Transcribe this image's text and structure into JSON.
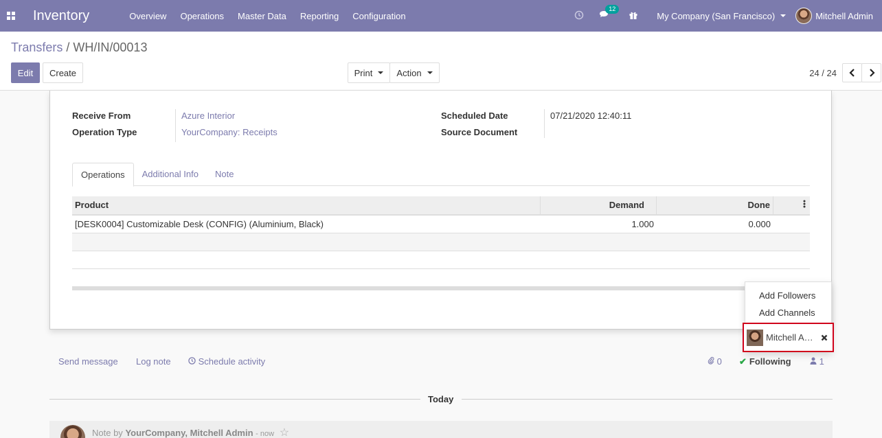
{
  "navbar": {
    "app_title": "Inventory",
    "menu": [
      "Overview",
      "Operations",
      "Master Data",
      "Reporting",
      "Configuration"
    ],
    "messages_count": "12",
    "company": "My Company (San Francisco)",
    "user": "Mitchell Admin"
  },
  "breadcrumb": {
    "parent": "Transfers",
    "separator": "/",
    "current": "WH/IN/00013"
  },
  "buttons": {
    "edit": "Edit",
    "create": "Create",
    "print": "Print",
    "action": "Action"
  },
  "pager": {
    "value": "24 / 24"
  },
  "form": {
    "receive_from_label": "Receive From",
    "receive_from": "Azure Interior",
    "operation_type_label": "Operation Type",
    "operation_type": "YourCompany: Receipts",
    "scheduled_date_label": "Scheduled Date",
    "scheduled_date": "07/21/2020 12:40:11",
    "source_document_label": "Source Document"
  },
  "tabs": [
    "Operations",
    "Additional Info",
    "Note"
  ],
  "table": {
    "headers": {
      "product": "Product",
      "demand": "Demand",
      "done": "Done"
    },
    "rows": [
      {
        "product": "[DESK0004] Customizable Desk (CONFIG) (Aluminium, Black)",
        "demand": "1.000",
        "done": "0.000"
      }
    ]
  },
  "followers_dropdown": {
    "add_followers": "Add Followers",
    "add_channels": "Add Channels",
    "follower_name": "Mitchell Admin"
  },
  "chatter": {
    "send_message": "Send message",
    "log_note": "Log note",
    "schedule_activity": "Schedule activity",
    "attachments": "0",
    "following": "Following",
    "followers_count": "1",
    "day": "Today",
    "note_prefix": "Note by",
    "note_author": "YourCompany, Mitchell Admin",
    "note_time": "now"
  },
  "colors": {
    "brand": "#7c7bad",
    "highlight_border": "#d0021b",
    "badge": "#00a09d"
  }
}
